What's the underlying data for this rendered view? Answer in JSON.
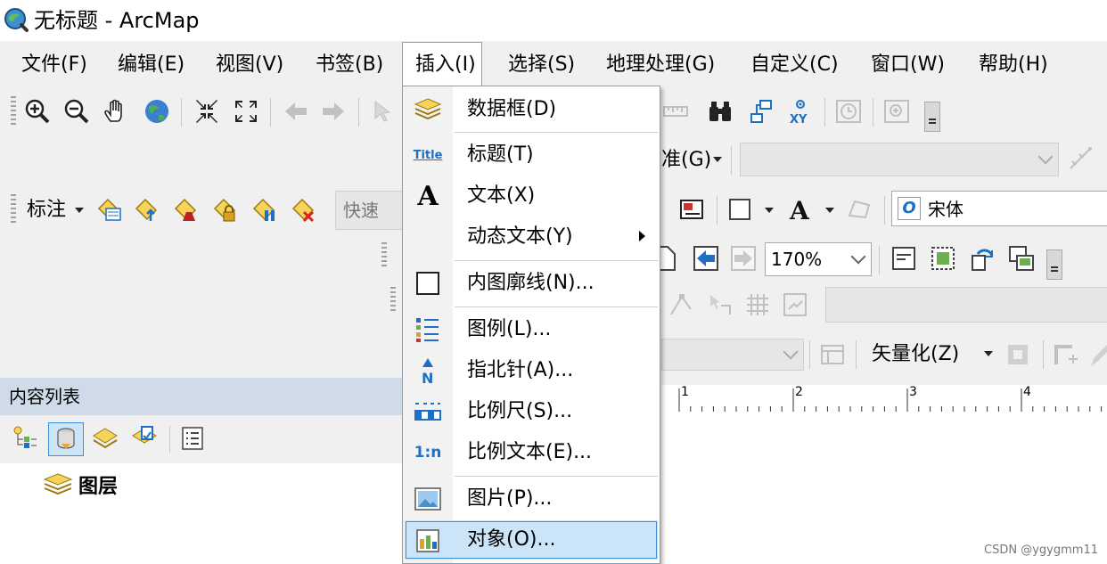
{
  "window": {
    "title": "无标题 - ArcMap"
  },
  "menu": {
    "items": [
      "文件(F)",
      "编辑(E)",
      "视图(V)",
      "书签(B)",
      "插入(I)",
      "选择(S)",
      "地理处理(G)",
      "自定义(C)",
      "窗口(W)",
      "帮助(H)"
    ]
  },
  "toolbars": {
    "label_toolbar": "标注",
    "quick_box": "快速",
    "standard_suffix": "准(G)",
    "font_name": "宋体",
    "zoom_level": "170%",
    "vectorize": "矢量化(Z)"
  },
  "dropdown": {
    "items": [
      {
        "label": "数据框(D)",
        "icon": "data-frame-icon"
      },
      {
        "label": "标题(T)",
        "icon": "title-icon",
        "glyph": "Title"
      },
      {
        "label": "文本(X)",
        "icon": "text-icon",
        "glyph": "A"
      },
      {
        "label": "动态文本(Y)",
        "icon": ""
      },
      {
        "label": "内图廓线(N)...",
        "icon": "neatline-icon"
      },
      {
        "label": "图例(L)...",
        "icon": "legend-icon"
      },
      {
        "label": "指北针(A)...",
        "icon": "north-arrow-icon",
        "glyph": "N"
      },
      {
        "label": "比例尺(S)...",
        "icon": "scale-bar-icon"
      },
      {
        "label": "比例文本(E)...",
        "icon": "scale-text-icon",
        "glyph": "1:n"
      },
      {
        "label": "图片(P)...",
        "icon": "picture-icon"
      },
      {
        "label": "对象(O)...",
        "icon": "object-icon"
      }
    ]
  },
  "toc": {
    "title": "内容列表",
    "root_layer": "图层"
  },
  "ruler": {
    "ticks": [
      "1",
      "2",
      "3",
      "4"
    ]
  },
  "watermark": "CSDN @ygygmm11",
  "colors": {
    "highlight": "#cce4f7",
    "toc_header": "#cfdbe8",
    "accent": "#3c8fd8"
  }
}
